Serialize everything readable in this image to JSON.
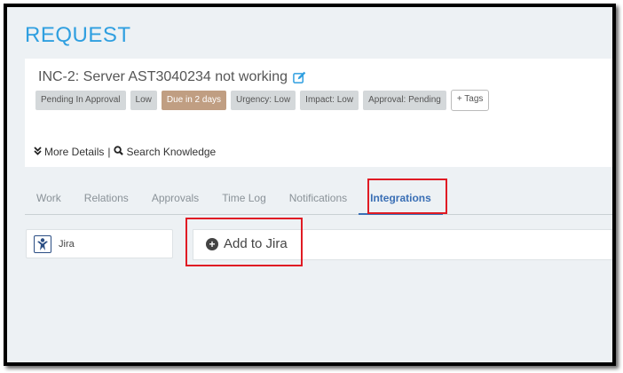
{
  "page_title": "REQUEST",
  "ticket": {
    "title": "INC-2: Server AST3040234 not working",
    "tags": [
      {
        "label": "Pending In Approval",
        "kind": "status"
      },
      {
        "label": "Low",
        "kind": "priority"
      },
      {
        "label": "Due in 2 days",
        "kind": "due"
      },
      {
        "label": "Urgency: Low",
        "kind": "urgency"
      },
      {
        "label": "Impact: Low",
        "kind": "impact"
      },
      {
        "label": "Approval: Pending",
        "kind": "approval"
      }
    ],
    "add_tags_label": "+ Tags",
    "more_details_label": "More Details",
    "separator": "|",
    "search_knowledge_label": "Search Knowledge"
  },
  "tabs": [
    {
      "label": "Work",
      "active": false
    },
    {
      "label": "Relations",
      "active": false
    },
    {
      "label": "Approvals",
      "active": false
    },
    {
      "label": "Time Log",
      "active": false
    },
    {
      "label": "Notifications",
      "active": false
    },
    {
      "label": "Integrations",
      "active": true
    }
  ],
  "integrations": [
    {
      "label": "Jira",
      "icon": "jira-icon"
    }
  ],
  "panel": {
    "add_button_label": "Add to Jira",
    "add_icon": "plus-circle-icon"
  },
  "colors": {
    "title_blue": "#2f9fe0",
    "active_tab": "#3a6fb5",
    "due_tag": "#c09e82",
    "highlight_red": "#e01b24"
  }
}
